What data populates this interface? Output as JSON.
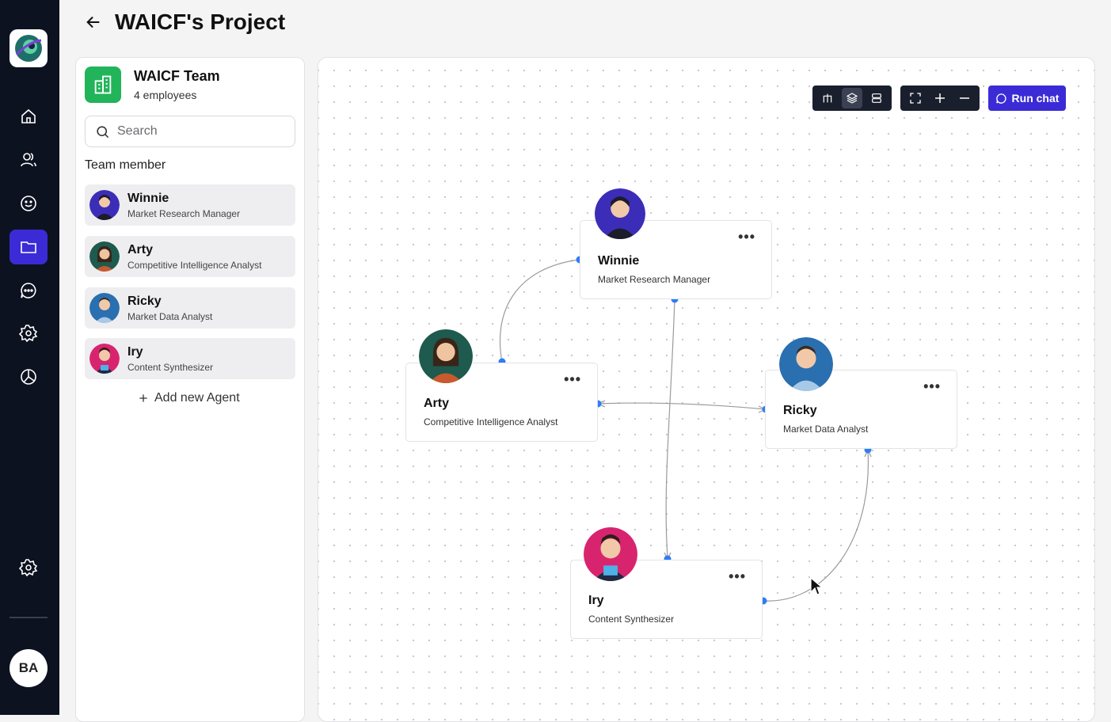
{
  "project": {
    "title": "WAICF's Project"
  },
  "user": {
    "initials": "BA"
  },
  "team": {
    "name": "WAICF Team",
    "count": "4 employees"
  },
  "search": {
    "placeholder": "Search"
  },
  "section_label": "Team member",
  "members": [
    {
      "name": "Winnie",
      "role": "Market Research Manager",
      "avatar_color": "#3b2db8"
    },
    {
      "name": "Arty",
      "role": "Competitive Intelligence Analyst",
      "avatar_color": "#1e5a4e"
    },
    {
      "name": "Ricky",
      "role": "Market Data Analyst",
      "avatar_color": "#2a6fb0"
    },
    {
      "name": "Iry",
      "role": "Content Synthesizer",
      "avatar_color": "#d8246f"
    }
  ],
  "add_agent_label": "Add new Agent",
  "toolbar": {
    "run_chat_label": "Run chat"
  },
  "nav_icons": [
    "home-icon",
    "users-icon",
    "smile-icon",
    "folder-icon",
    "chat-icon",
    "settings-icon",
    "chart-pie-icon"
  ],
  "colors": {
    "accent": "#3b2bd6",
    "rail": "#0d1220",
    "team_logo": "#22b45a",
    "edge_dot": "#2f7cf6"
  }
}
